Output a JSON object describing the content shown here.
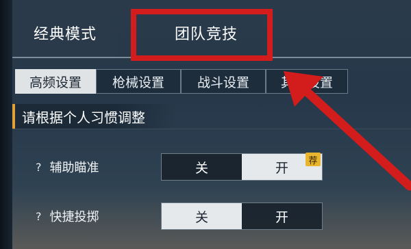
{
  "mode_tabs": [
    {
      "label": "经典模式",
      "active": true
    },
    {
      "label": "团队竞技",
      "active": false
    }
  ],
  "sub_tabs": [
    {
      "label": "高频设置",
      "active": true
    },
    {
      "label": "枪械设置",
      "active": false
    },
    {
      "label": "战斗设置",
      "active": false
    },
    {
      "label": "其他设置",
      "active": false
    }
  ],
  "section_title": "请根据个人习惯调整",
  "settings": [
    {
      "help": "?",
      "label": "辅助瞄准",
      "off": "关",
      "on": "开",
      "selected": "开",
      "badge": "荐"
    },
    {
      "help": "?",
      "label": "快捷投掷",
      "off": "关",
      "on": "开",
      "selected": "关"
    }
  ],
  "annotation_color": "#d31c1c"
}
